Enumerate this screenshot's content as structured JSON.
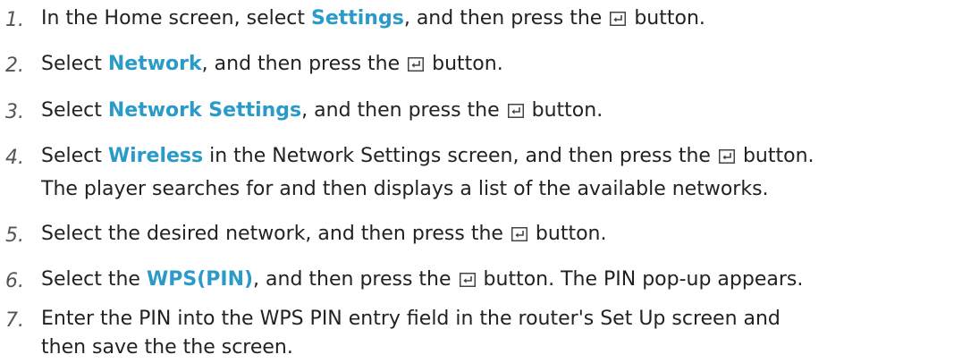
{
  "enter_icon": "enter-key-icon",
  "accent_color": "#2a9bc9",
  "steps": [
    {
      "num": "1.",
      "a": "In the Home screen, select ",
      "hl": "Settings",
      "b": ", and then press the ",
      "c": " button."
    },
    {
      "num": "2.",
      "a": "Select ",
      "hl": "Network",
      "b": ", and then press the ",
      "c": " button."
    },
    {
      "num": "3.",
      "a": "Select ",
      "hl": "Network Settings",
      "b": ", and then press the ",
      "c": " button."
    },
    {
      "num": "4.",
      "a": "Select ",
      "hl": "Wireless",
      "b": " in the Network Settings screen, and then press the ",
      "c": " button.",
      "line2": "The player searches for and then displays a list of the available networks."
    },
    {
      "num": "5.",
      "a": "Select the desired network, and then press the ",
      "c": " button."
    },
    {
      "num": "6.",
      "a": "Select the ",
      "hl": "WPS(PIN)",
      "b": ", and then press the ",
      "c": " button. The PIN pop-up appears."
    },
    {
      "num": "7.",
      "a": "Enter the PIN into the WPS PIN entry field in the router's Set Up screen and",
      "line2": "then save the the screen."
    }
  ]
}
